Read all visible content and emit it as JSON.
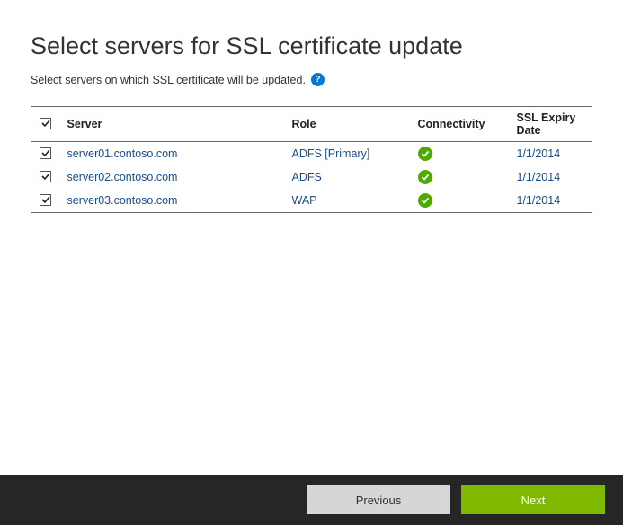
{
  "title": "Select servers for SSL certificate update",
  "subtitle": "Select servers on which SSL certificate will be updated.",
  "columns": {
    "server": "Server",
    "role": "Role",
    "connectivity": "Connectivity",
    "expiry": "SSL Expiry Date"
  },
  "rows": [
    {
      "checked": true,
      "server": "server01.contoso.com",
      "role": "ADFS [Primary]",
      "connectivity": "ok",
      "expiry": "1/1/2014"
    },
    {
      "checked": true,
      "server": "server02.contoso.com",
      "role": "ADFS",
      "connectivity": "ok",
      "expiry": "1/1/2014"
    },
    {
      "checked": true,
      "server": "server03.contoso.com",
      "role": "WAP",
      "connectivity": "ok",
      "expiry": "1/1/2014"
    }
  ],
  "buttons": {
    "previous": "Previous",
    "next": "Next"
  }
}
